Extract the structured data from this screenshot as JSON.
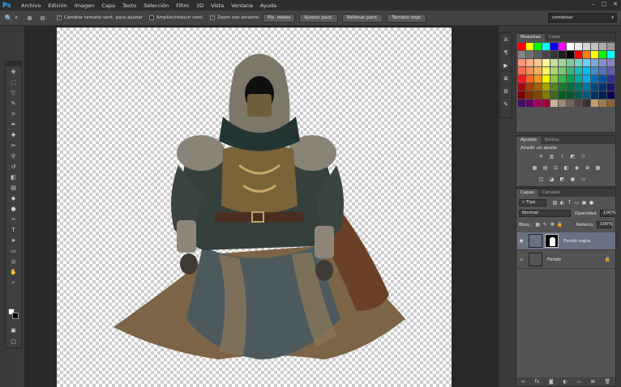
{
  "app": {
    "logo": "Ps"
  },
  "menu": [
    "Archivo",
    "Edición",
    "Imagen",
    "Capa",
    "Texto",
    "Selección",
    "Filtro",
    "3D",
    "Vista",
    "Ventana",
    "Ayuda"
  ],
  "window_controls": {
    "minimize": "–",
    "maximize": "□",
    "close": "✕"
  },
  "options_bar": {
    "tool_icon": "zoom-icon",
    "checkboxes": [
      {
        "label": "Cambiar tamaño vent. para ajustar",
        "checked": true
      },
      {
        "label": "Ampliar/reducir vent.",
        "checked": false
      },
      {
        "label": "Zoom con arrastre",
        "checked": true
      }
    ],
    "buttons": [
      "Píx. reales",
      "Ajustar pant.",
      "Rellenar pant.",
      "Tamaño impr."
    ],
    "workspace": "combinar"
  },
  "swatches_panel": {
    "tabs": [
      "Muestras",
      "Color"
    ],
    "colors": [
      "#ff0000",
      "#ffff00",
      "#00ff00",
      "#00ffff",
      "#0000ff",
      "#ff00ff",
      "#ffffff",
      "#ebebeb",
      "#d6d6d6",
      "#c2c2c2",
      "#adadad",
      "#999999",
      "#858585",
      "#707070",
      "#5c5c5c",
      "#474747",
      "#333333",
      "#1f1f1f",
      "#000000",
      "#ff0000",
      "#ff7f00",
      "#ffff00",
      "#00ff00",
      "#00ffff",
      "#f7977a",
      "#f9ad81",
      "#fdc68a",
      "#fff79a",
      "#c4df9b",
      "#a2d39c",
      "#82ca9d",
      "#7bcdc8",
      "#6ecff6",
      "#7ea7d8",
      "#8493ca",
      "#8882be",
      "#f26c4f",
      "#f68e55",
      "#fbaf5c",
      "#fff467",
      "#acd372",
      "#7cc576",
      "#3bb878",
      "#1abbb4",
      "#00bff3",
      "#438ccb",
      "#5574b9",
      "#605ca8",
      "#ed1c24",
      "#f26522",
      "#f7941d",
      "#fff200",
      "#8dc73f",
      "#39b54a",
      "#00a651",
      "#00a99d",
      "#00aeef",
      "#0072bc",
      "#0054a6",
      "#2e3192",
      "#9e0b0f",
      "#a0410d",
      "#a3620a",
      "#aba000",
      "#598527",
      "#1a7b30",
      "#007236",
      "#00746b",
      "#0076a3",
      "#004b80",
      "#003471",
      "#1b1464",
      "#790000",
      "#7b2e00",
      "#7d4900",
      "#827b00",
      "#406618",
      "#005e20",
      "#005826",
      "#005952",
      "#005b7f",
      "#003663",
      "#002157",
      "#0d004c",
      "#440e62",
      "#630460",
      "#9e005d",
      "#9e0039",
      "#c7b299",
      "#998675",
      "#736357",
      "#534741",
      "#37302d",
      "#c69c6d",
      "#a67c52",
      "#8c6239"
    ]
  },
  "adjustments_panel": {
    "tabs": [
      "Ajustes",
      "Estilos"
    ],
    "title": "Añadir un ajuste",
    "row1": [
      "brightness-icon",
      "levels-icon",
      "curves-icon",
      "exposure-icon",
      "gradient-triangle-icon"
    ],
    "row2": [
      "vibrance-icon",
      "hue-saturation-icon",
      "color-balance-icon",
      "black-white-icon",
      "photo-filter-icon",
      "channel-mixer-icon",
      "color-lookup-icon"
    ],
    "row3": [
      "invert-icon",
      "posterize-icon",
      "threshold-icon",
      "selective-color-icon",
      "gradient-map-icon"
    ]
  },
  "layers_panel": {
    "tabs": [
      "Capas",
      "Canales"
    ],
    "filter": "Tipo",
    "blend_mode": "Normal",
    "opacity_label": "Opacidad:",
    "opacity": "100%",
    "lock_label": "Bloq.:",
    "fill_label": "Relleno:",
    "fill": "100%",
    "layers": [
      {
        "name": "Fondo copia",
        "visible": true,
        "active": true,
        "has_mask": true
      },
      {
        "name": "Fondo",
        "visible": false,
        "active": false,
        "locked": true
      }
    ],
    "footer": [
      "link-icon",
      "fx-icon",
      "mask-icon",
      "adjustment-icon",
      "folder-icon",
      "new-layer-icon",
      "trash-icon"
    ]
  },
  "colors": {
    "foreground": "#ffffff",
    "background": "#000000",
    "active_layer": "#6a7182"
  }
}
